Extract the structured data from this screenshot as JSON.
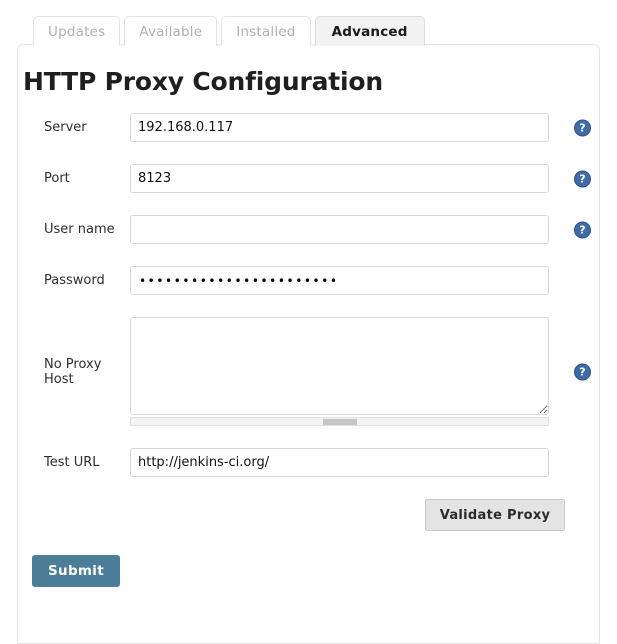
{
  "tabs": [
    {
      "label": "Updates",
      "active": false
    },
    {
      "label": "Available",
      "active": false
    },
    {
      "label": "Installed",
      "active": false
    },
    {
      "label": "Advanced",
      "active": true
    }
  ],
  "page": {
    "title": "HTTP Proxy Configuration"
  },
  "form": {
    "server": {
      "label": "Server",
      "value": "192.168.0.117",
      "placeholder": "",
      "help_icon": "help-circle-icon",
      "has_help": true
    },
    "port": {
      "label": "Port",
      "value": "8123",
      "placeholder": "",
      "help_icon": "help-circle-icon",
      "has_help": true
    },
    "username": {
      "label": "User name",
      "value": "",
      "placeholder": "",
      "help_icon": "help-circle-icon",
      "has_help": true
    },
    "password": {
      "label": "Password",
      "value": "•••••••••••••••••••••••",
      "placeholder": "",
      "has_help": false
    },
    "no_proxy_host": {
      "label": "No Proxy Host",
      "value": "",
      "placeholder": "",
      "help_icon": "help-circle-icon",
      "has_help": true
    },
    "test_url": {
      "label": "Test URL",
      "value": "http://jenkins-ci.org/",
      "placeholder": "",
      "has_help": false
    }
  },
  "buttons": {
    "validate": "Validate Proxy",
    "submit": "Submit"
  },
  "icons": {
    "help": "?"
  },
  "colors": {
    "submit_bg": "#4d7e99",
    "help_icon_bg": "#3f6ba8",
    "active_tab_bg": "#f2f2f2",
    "inactive_tab_text": "#b0b0b0"
  }
}
